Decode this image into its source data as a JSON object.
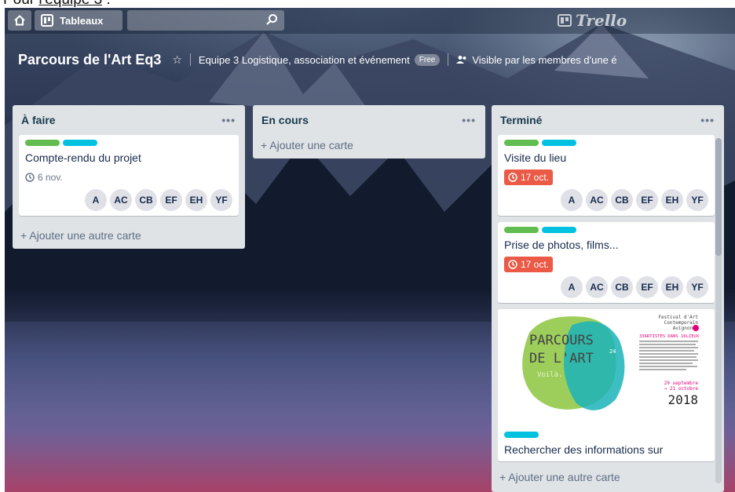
{
  "caption": {
    "prefix": "Pour ",
    "underlined": "l'équipe 3",
    "suffix": " :"
  },
  "header": {
    "boards_label": "Tableaux",
    "logo_text": "Trello"
  },
  "board": {
    "title": "Parcours de l'Art Eq3",
    "team": "Equipe 3 Logistique, association et événement",
    "team_badge": "Free",
    "visibility": "Visible par les membres d'une é"
  },
  "lists": [
    {
      "title": "À faire",
      "cards": [
        {
          "title": "Compte-rendu du projet",
          "due": "6 nov.",
          "members": [
            "A",
            "AC",
            "CB",
            "EF",
            "EH",
            "YF"
          ]
        }
      ],
      "add_label": "+ Ajouter une autre carte"
    },
    {
      "title": "En cours",
      "add_label": "+ Ajouter une carte"
    },
    {
      "title": "Terminé",
      "cards": [
        {
          "title": "Visite du lieu",
          "due": "17 oct.",
          "members": [
            "A",
            "AC",
            "CB",
            "EF",
            "EH",
            "YF"
          ]
        },
        {
          "title": "Prise de photos, films...",
          "due": "17 oct.",
          "members": [
            "A",
            "AC",
            "CB",
            "EF",
            "EH",
            "YF"
          ]
        },
        {
          "title": "Rechercher des informations sur",
          "cover": {
            "line1": "PARCOURS",
            "line2": "DE L'ART",
            "edition": "24",
            "tag": "Voilà.",
            "festival": [
              "Festival d'Art",
              "Contemporain",
              "Avignon"
            ],
            "artists": "33ARTISTES DANS 16LIEUX",
            "dates": [
              "29 septembre",
              "→ 21 octobre"
            ],
            "year": "2018"
          }
        }
      ],
      "add_label": "+ Ajouter une autre carte"
    }
  ],
  "colors": {
    "label_green": "#61bd4f",
    "label_cyan": "#00c2e0",
    "due_late": "#eb5a46",
    "list_bg": "#dfe3e6"
  }
}
